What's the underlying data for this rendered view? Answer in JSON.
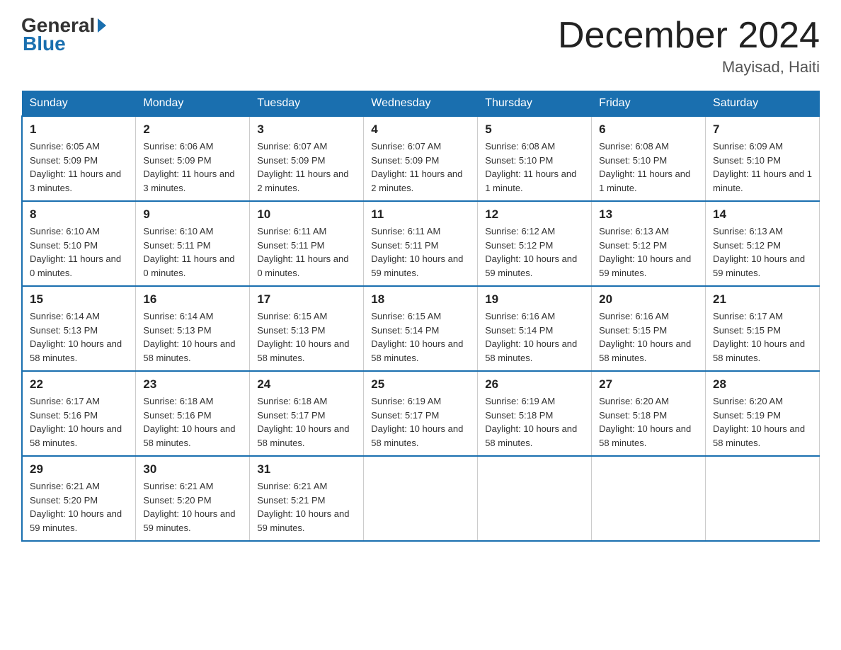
{
  "header": {
    "logo_general": "General",
    "logo_blue": "Blue",
    "title": "December 2024",
    "location": "Mayisad, Haiti"
  },
  "days_of_week": [
    "Sunday",
    "Monday",
    "Tuesday",
    "Wednesday",
    "Thursday",
    "Friday",
    "Saturday"
  ],
  "weeks": [
    [
      {
        "day": "1",
        "sunrise": "6:05 AM",
        "sunset": "5:09 PM",
        "daylight": "11 hours and 3 minutes."
      },
      {
        "day": "2",
        "sunrise": "6:06 AM",
        "sunset": "5:09 PM",
        "daylight": "11 hours and 3 minutes."
      },
      {
        "day": "3",
        "sunrise": "6:07 AM",
        "sunset": "5:09 PM",
        "daylight": "11 hours and 2 minutes."
      },
      {
        "day": "4",
        "sunrise": "6:07 AM",
        "sunset": "5:09 PM",
        "daylight": "11 hours and 2 minutes."
      },
      {
        "day": "5",
        "sunrise": "6:08 AM",
        "sunset": "5:10 PM",
        "daylight": "11 hours and 1 minute."
      },
      {
        "day": "6",
        "sunrise": "6:08 AM",
        "sunset": "5:10 PM",
        "daylight": "11 hours and 1 minute."
      },
      {
        "day": "7",
        "sunrise": "6:09 AM",
        "sunset": "5:10 PM",
        "daylight": "11 hours and 1 minute."
      }
    ],
    [
      {
        "day": "8",
        "sunrise": "6:10 AM",
        "sunset": "5:10 PM",
        "daylight": "11 hours and 0 minutes."
      },
      {
        "day": "9",
        "sunrise": "6:10 AM",
        "sunset": "5:11 PM",
        "daylight": "11 hours and 0 minutes."
      },
      {
        "day": "10",
        "sunrise": "6:11 AM",
        "sunset": "5:11 PM",
        "daylight": "11 hours and 0 minutes."
      },
      {
        "day": "11",
        "sunrise": "6:11 AM",
        "sunset": "5:11 PM",
        "daylight": "10 hours and 59 minutes."
      },
      {
        "day": "12",
        "sunrise": "6:12 AM",
        "sunset": "5:12 PM",
        "daylight": "10 hours and 59 minutes."
      },
      {
        "day": "13",
        "sunrise": "6:13 AM",
        "sunset": "5:12 PM",
        "daylight": "10 hours and 59 minutes."
      },
      {
        "day": "14",
        "sunrise": "6:13 AM",
        "sunset": "5:12 PM",
        "daylight": "10 hours and 59 minutes."
      }
    ],
    [
      {
        "day": "15",
        "sunrise": "6:14 AM",
        "sunset": "5:13 PM",
        "daylight": "10 hours and 58 minutes."
      },
      {
        "day": "16",
        "sunrise": "6:14 AM",
        "sunset": "5:13 PM",
        "daylight": "10 hours and 58 minutes."
      },
      {
        "day": "17",
        "sunrise": "6:15 AM",
        "sunset": "5:13 PM",
        "daylight": "10 hours and 58 minutes."
      },
      {
        "day": "18",
        "sunrise": "6:15 AM",
        "sunset": "5:14 PM",
        "daylight": "10 hours and 58 minutes."
      },
      {
        "day": "19",
        "sunrise": "6:16 AM",
        "sunset": "5:14 PM",
        "daylight": "10 hours and 58 minutes."
      },
      {
        "day": "20",
        "sunrise": "6:16 AM",
        "sunset": "5:15 PM",
        "daylight": "10 hours and 58 minutes."
      },
      {
        "day": "21",
        "sunrise": "6:17 AM",
        "sunset": "5:15 PM",
        "daylight": "10 hours and 58 minutes."
      }
    ],
    [
      {
        "day": "22",
        "sunrise": "6:17 AM",
        "sunset": "5:16 PM",
        "daylight": "10 hours and 58 minutes."
      },
      {
        "day": "23",
        "sunrise": "6:18 AM",
        "sunset": "5:16 PM",
        "daylight": "10 hours and 58 minutes."
      },
      {
        "day": "24",
        "sunrise": "6:18 AM",
        "sunset": "5:17 PM",
        "daylight": "10 hours and 58 minutes."
      },
      {
        "day": "25",
        "sunrise": "6:19 AM",
        "sunset": "5:17 PM",
        "daylight": "10 hours and 58 minutes."
      },
      {
        "day": "26",
        "sunrise": "6:19 AM",
        "sunset": "5:18 PM",
        "daylight": "10 hours and 58 minutes."
      },
      {
        "day": "27",
        "sunrise": "6:20 AM",
        "sunset": "5:18 PM",
        "daylight": "10 hours and 58 minutes."
      },
      {
        "day": "28",
        "sunrise": "6:20 AM",
        "sunset": "5:19 PM",
        "daylight": "10 hours and 58 minutes."
      }
    ],
    [
      {
        "day": "29",
        "sunrise": "6:21 AM",
        "sunset": "5:20 PM",
        "daylight": "10 hours and 59 minutes."
      },
      {
        "day": "30",
        "sunrise": "6:21 AM",
        "sunset": "5:20 PM",
        "daylight": "10 hours and 59 minutes."
      },
      {
        "day": "31",
        "sunrise": "6:21 AM",
        "sunset": "5:21 PM",
        "daylight": "10 hours and 59 minutes."
      },
      null,
      null,
      null,
      null
    ]
  ]
}
